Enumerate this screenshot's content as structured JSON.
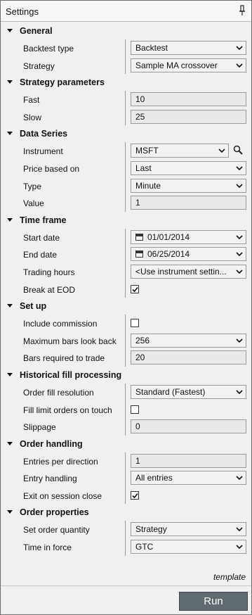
{
  "window": {
    "title": "Settings"
  },
  "sections": [
    {
      "label": "General",
      "props": [
        {
          "name": "backtest-type",
          "label": "Backtest type",
          "kind": "dropdown",
          "value": "Backtest"
        },
        {
          "name": "strategy",
          "label": "Strategy",
          "kind": "dropdown",
          "value": "Sample MA crossover"
        }
      ]
    },
    {
      "label": "Strategy parameters",
      "props": [
        {
          "name": "fast",
          "label": "Fast",
          "kind": "input",
          "value": "10"
        },
        {
          "name": "slow",
          "label": "Slow",
          "kind": "input",
          "value": "25"
        }
      ]
    },
    {
      "label": "Data Series",
      "props": [
        {
          "name": "instrument",
          "label": "Instrument",
          "kind": "instrument",
          "value": "MSFT"
        },
        {
          "name": "price-based-on",
          "label": "Price based on",
          "kind": "dropdown",
          "value": "Last"
        },
        {
          "name": "type",
          "label": "Type",
          "kind": "dropdown",
          "value": "Minute"
        },
        {
          "name": "value",
          "label": "Value",
          "kind": "input",
          "value": "1"
        }
      ]
    },
    {
      "label": "Time frame",
      "props": [
        {
          "name": "start-date",
          "label": "Start date",
          "kind": "date",
          "value": "01/01/2014"
        },
        {
          "name": "end-date",
          "label": "End date",
          "kind": "date",
          "value": "06/25/2014"
        },
        {
          "name": "trading-hours",
          "label": "Trading hours",
          "kind": "dropdown",
          "value": "<Use instrument settin..."
        },
        {
          "name": "break-at-eod",
          "label": "Break at EOD",
          "kind": "checkbox",
          "checked": true
        }
      ]
    },
    {
      "label": "Set up",
      "props": [
        {
          "name": "include-commission",
          "label": "Include commission",
          "kind": "checkbox",
          "checked": false
        },
        {
          "name": "maximum-bars-look-back",
          "label": "Maximum bars look back",
          "kind": "dropdown",
          "value": "256"
        },
        {
          "name": "bars-required-to-trade",
          "label": "Bars required to trade",
          "kind": "input",
          "value": "20"
        }
      ]
    },
    {
      "label": "Historical fill processing",
      "props": [
        {
          "name": "order-fill-resolution",
          "label": "Order fill resolution",
          "kind": "dropdown",
          "value": "Standard (Fastest)"
        },
        {
          "name": "fill-limit-orders-on-touch",
          "label": "Fill limit orders on touch",
          "kind": "checkbox",
          "checked": false
        },
        {
          "name": "slippage",
          "label": "Slippage",
          "kind": "input",
          "value": "0"
        }
      ]
    },
    {
      "label": "Order handling",
      "props": [
        {
          "name": "entries-per-direction",
          "label": "Entries per direction",
          "kind": "input",
          "value": "1"
        },
        {
          "name": "entry-handling",
          "label": "Entry handling",
          "kind": "dropdown",
          "value": "All entries"
        },
        {
          "name": "exit-on-session-close",
          "label": "Exit on session close",
          "kind": "checkbox",
          "checked": true
        }
      ]
    },
    {
      "label": "Order properties",
      "props": [
        {
          "name": "set-order-quantity",
          "label": "Set order quantity",
          "kind": "dropdown",
          "value": "Strategy"
        },
        {
          "name": "time-in-force",
          "label": "Time in force",
          "kind": "dropdown",
          "value": "GTC"
        }
      ]
    }
  ],
  "footer": {
    "template_label": "template",
    "run_label": "Run"
  },
  "colors": {
    "run_button": "#606b70",
    "border": "#9a9a9a",
    "background": "#f0f0f0"
  }
}
